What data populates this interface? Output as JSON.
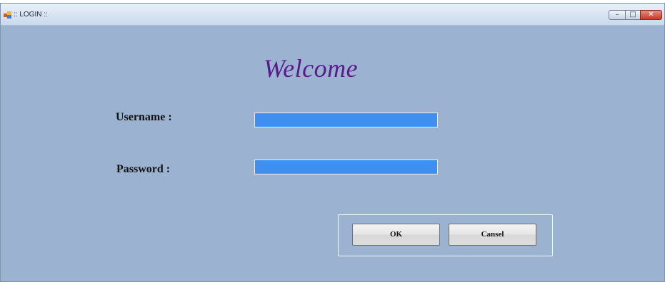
{
  "window": {
    "title": ":: LOGIN ::",
    "controls": {
      "minimize": "–",
      "maximize": "□",
      "close": "✕"
    }
  },
  "form": {
    "heading": "Welcome",
    "username_label": "Username :",
    "password_label": "Password  :",
    "username_value": "",
    "password_value": ""
  },
  "buttons": {
    "ok": "OK",
    "cancel": "Cansel"
  },
  "colors": {
    "form_background": "#9bb3d1",
    "heading": "#5a1a8c",
    "input_background": "#3f8ff0",
    "close_button": "#c63a27"
  },
  "icons": {
    "app": "application-icon",
    "minimize": "minimize-icon",
    "maximize": "maximize-icon",
    "close": "close-icon"
  }
}
